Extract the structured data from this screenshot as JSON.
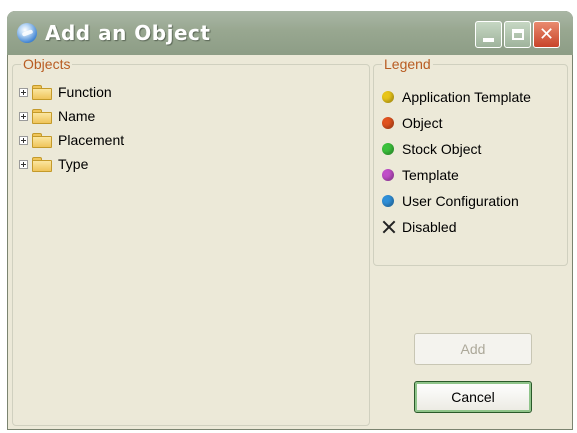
{
  "window": {
    "title": "Add an Object",
    "controls": {
      "minimize": "minimize",
      "maximize": "maximize",
      "close": "close"
    }
  },
  "objects": {
    "group_label": "Objects",
    "items": [
      {
        "label": "Function",
        "icon": "folder-icon"
      },
      {
        "label": "Name",
        "icon": "folder-icon"
      },
      {
        "label": "Placement",
        "icon": "folder-icon"
      },
      {
        "label": "Type",
        "icon": "folder-icon"
      }
    ]
  },
  "legend": {
    "group_label": "Legend",
    "items": [
      {
        "label": "Application Template",
        "color": "#e8c51a"
      },
      {
        "label": "Object",
        "color": "#e0531f"
      },
      {
        "label": "Stock Object",
        "color": "#3cc13c"
      },
      {
        "label": "Template",
        "color": "#c04ec8"
      },
      {
        "label": "User Configuration",
        "color": "#2f8fd8"
      },
      {
        "label": "Disabled",
        "icon": "x-icon"
      }
    ]
  },
  "buttons": {
    "add": "Add",
    "cancel": "Cancel"
  },
  "colors": {
    "titlebar": "#98a790",
    "window_bg": "#ece9d8",
    "group_label": "#b85c22",
    "close_button": "#c8442a"
  }
}
